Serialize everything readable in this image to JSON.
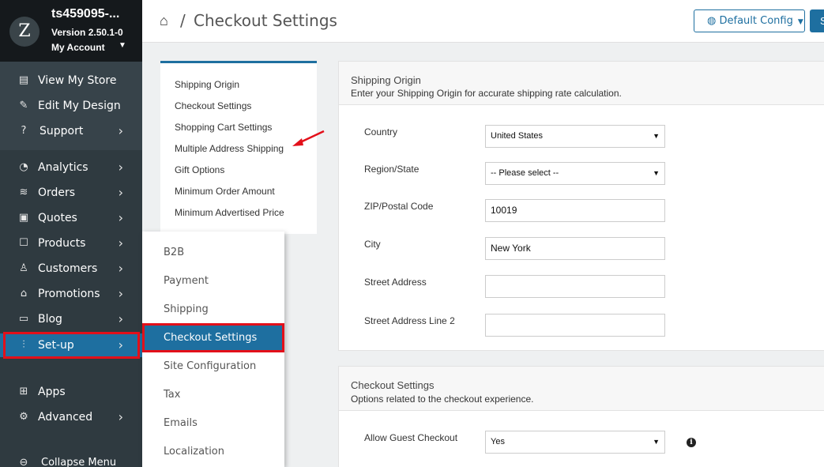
{
  "brand": {
    "logo": "Z",
    "store_name": "ts459095-...",
    "version": "Version 2.50.1-0",
    "account_label": "My Account"
  },
  "sidebar": {
    "items": [
      {
        "label": "View My Store",
        "icon": "store-icon"
      },
      {
        "label": "Edit My Design",
        "icon": "pencil-icon"
      },
      {
        "label": "Support",
        "icon": "help-icon"
      },
      {
        "label": "Analytics",
        "icon": "gauge-icon"
      },
      {
        "label": "Orders",
        "icon": "database-icon"
      },
      {
        "label": "Quotes",
        "icon": "quotes-icon"
      },
      {
        "label": "Products",
        "icon": "box-icon"
      },
      {
        "label": "Customers",
        "icon": "user-icon"
      },
      {
        "label": "Promotions",
        "icon": "tag-icon"
      },
      {
        "label": "Blog",
        "icon": "book-icon"
      },
      {
        "label": "Set-up",
        "icon": "sliders-icon"
      },
      {
        "label": "Apps",
        "icon": "apps-icon"
      },
      {
        "label": "Advanced",
        "icon": "gear-icon"
      },
      {
        "label": "Collapse Menu",
        "icon": "collapse-icon"
      }
    ]
  },
  "header": {
    "breadcrumb_sep": "/",
    "title": "Checkout Settings",
    "config_label": "Default Config",
    "save_label": "S"
  },
  "section_nav": [
    "Shipping Origin",
    "Checkout Settings",
    "Shopping Cart Settings",
    "Multiple Address Shipping",
    "Gift Options",
    "Minimum Order Amount",
    "Minimum Advertised Price"
  ],
  "flyout": [
    "B2B",
    "Payment",
    "Shipping",
    "Checkout Settings",
    "Site Configuration",
    "Tax",
    "Emails",
    "Localization"
  ],
  "shipping_origin": {
    "title": "Shipping Origin",
    "subtitle": "Enter your Shipping Origin for accurate shipping rate calculation.",
    "fields": {
      "country_label": "Country",
      "country_value": "United States",
      "region_label": "Region/State",
      "region_value": "-- Please select --",
      "zip_label": "ZIP/Postal Code",
      "zip_value": "10019",
      "city_label": "City",
      "city_value": "New York",
      "street_label": "Street Address",
      "street_value": "",
      "street2_label": "Street Address Line 2",
      "street2_value": ""
    }
  },
  "checkout_settings": {
    "title": "Checkout Settings",
    "subtitle": "Options related to the checkout experience.",
    "guest_label": "Allow Guest Checkout",
    "guest_value": "Yes",
    "info": "i"
  },
  "colors": {
    "accent": "#1e6fa0",
    "highlight": "#e3101a",
    "sidebar": "#2f3a40"
  }
}
